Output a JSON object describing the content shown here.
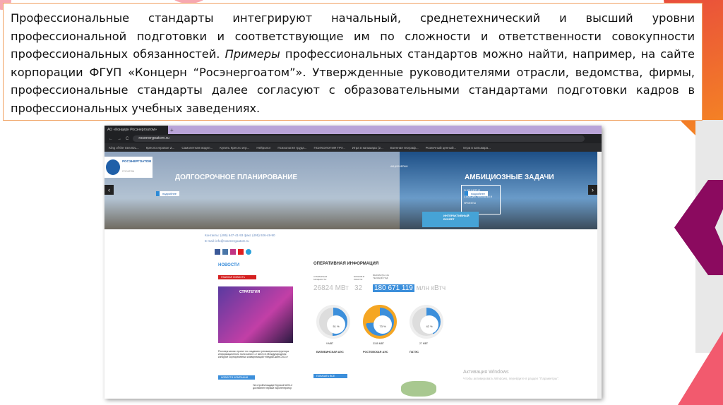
{
  "slide": {
    "paragraph": {
      "p1": "Профессиональные стандарты интегрируют начальный, среднетехнический и высший уровни профессиональной подготовки и соответствующие им по сложности и ответственности совокупности профессиональных обязанностей. ",
      "em": "Примеры",
      "p2": " профессиональных стандартов можно найти, например, на сайте корпорации ФГУП «Концерн “Росэнергоатом”». Утвержденные руководителями отрасли, ведомства, фирмы, профессиональные стандарты далее согласуют с образовательными стандартами подготовки кадров в профессиональных учебных заведениях."
    },
    "colors": {
      "border": "#f0a060",
      "orange": "#f47c20",
      "purple": "#8b0a5f",
      "pink": "#f25a6e"
    }
  },
  "browser": {
    "tab_title": "АО «Концерн Росэнергоатом»",
    "url": "rosenergoatom.ru",
    "bookmarks": [
      "King of the Sea IDL...",
      "Кресло игровое Z...",
      "Самолетная модел...",
      "Купить Кресло игр...",
      "Нейролог",
      "Психология труда...",
      "ПСИХОЛОГИЯ ТРУ...",
      "Игра в кальмара (2...",
      "Военная географ...",
      "Розничный ценный...",
      "Игра в кальмара..."
    ]
  },
  "site": {
    "logo": "РОСЭНЕРГОАТОМ",
    "logo_sub": "РОСАТОМ",
    "slide1_title": "ДОЛГОСРОЧНОЕ ПЛАНИРОВАНИЕ",
    "slide2_title": "АМБИЦИОЗНЫЕ ЗАДАЧИ",
    "more": "подробнее",
    "menu": [
      "О КОНЦЕРНЕ",
      "СТАНЦИИ, ФИЛИАЛЫ И ПРОЕКТЫ"
    ],
    "nav_last": "АКЦИОНЕРАМ",
    "booklet": "ИНТЕРАКТИВНЫЙ БУКЛЕТ",
    "contacts": "Контакты: (495) 647-41-93 факс (495) 926-49-90",
    "email": "E-mail: info@rosenergoatom.ru",
    "news_title": "НОВОСТИ",
    "main_news": "ГЛАВНАЯ НОВОСТЬ",
    "news_image_text": "СТРАТЕГИЯ",
    "news_text": "Росэнергоатом: проект по созданию тренажера-конструктора информационного поля занял 1-е место в Международном конкурсе корпоративных коммуникаций «МедиаСкипп-2021»",
    "company_news": "НОВОСТИ КОМПАНИИ",
    "news2": "На стройплощадке Курской АЭС-2 доставлен первый парогенератор",
    "op_title": "ОПЕРАТИВНАЯ ИНФОРМАЦИЯ",
    "power_label": "СУММАРНАЯ МОЩНОСТЬ:",
    "power": "26824 МВт",
    "units_label": "БЛОКОВ В РАБОТЕ:",
    "units": "32",
    "output_label": "ВЫРАБОТКА ЗА ТЕКУЩИЙ ГОД:",
    "output": "180 671 119",
    "output_unit": "млн кВтч",
    "stations": [
      {
        "name": "БИЛИБИНСКАЯ АЭС",
        "mw": "9 МВТ",
        "pct": "51 %",
        "value": 51
      },
      {
        "name": "РОСТОВСКАЯ АЭС",
        "mw": "3155 МВТ",
        "pct": "73 %",
        "value": 73
      },
      {
        "name": "ПАТЭС",
        "mw": "27 МВТ",
        "pct": "42 %",
        "value": 42
      }
    ],
    "show_all": "ПОКАЗАТЬ ВСЕ"
  },
  "windows": {
    "title": "Активация Windows",
    "sub": "Чтобы активировать Windows, перейдите в раздел \"Параметры\"."
  }
}
